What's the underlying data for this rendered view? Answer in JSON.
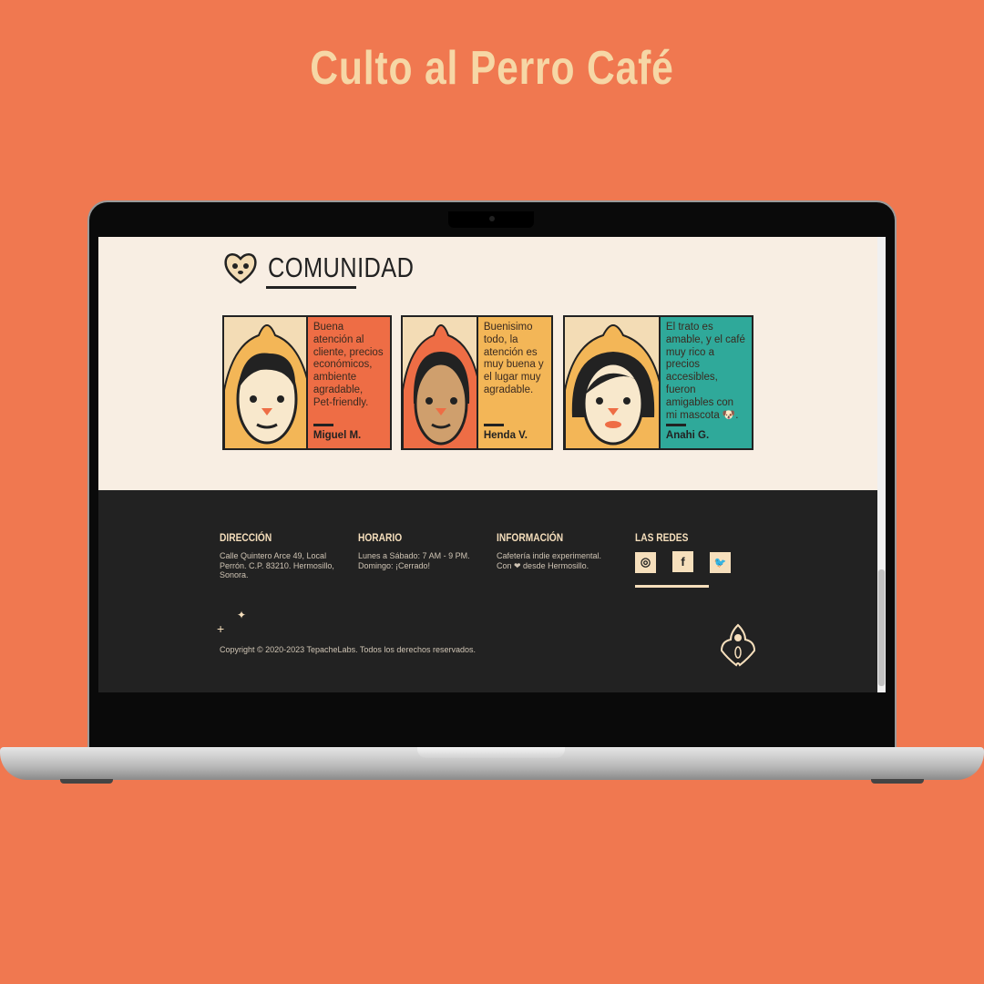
{
  "promo": {
    "title": "Culto al Perro Café"
  },
  "section": {
    "heading": "COMUNIDAD"
  },
  "testimonials": [
    {
      "text": "Buena atención al cliente, precios económicos, ambiente agradable, Pet-friendly.",
      "name": "Miguel M.",
      "color": "#ee6d45"
    },
    {
      "text": "Buenisimo todo, la atención es muy buena y el lugar muy agradable.",
      "name": "Henda V.",
      "color": "#f3b657"
    },
    {
      "text": "El trato es amable, y el café muy rico a precios accesibles, fueron amigables con mi mascota 🐶.",
      "name": "Anahi G.",
      "color": "#2fa99a"
    }
  ],
  "footer": {
    "direccion": {
      "title": "DIRECCIÓN",
      "text": "Calle Quintero Arce 49, Local Perrón. C.P. 83210. Hermosillo, Sonora."
    },
    "horario": {
      "title": "HORARIO",
      "line1": "Lunes a Sábado: 7 AM - 9 PM.",
      "line2": "Domingo: ¡Cerrado!"
    },
    "informacion": {
      "title": "INFORMACIÓN",
      "line1": "Cafetería indie experimental.",
      "line2": "Con ❤ desde Hermosillo."
    },
    "redes": {
      "title": "LAS REDES",
      "instagram": "◎",
      "facebook": "f",
      "twitter": "🐦"
    },
    "copyright": "Copyright © 2020-2023 TepacheLabs. Todos los derechos reservados."
  }
}
